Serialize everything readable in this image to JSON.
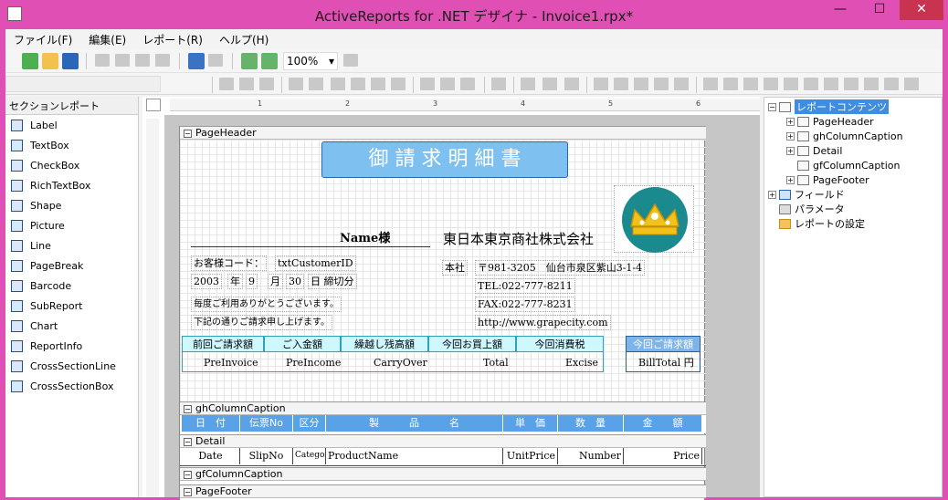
{
  "window": {
    "title": "ActiveReports for .NET デザイナ - Invoice1.rpx*",
    "close_glyph": "✕",
    "minimize_glyph": "—",
    "maximize_glyph": "☐"
  },
  "menu": [
    "ファイル(F)",
    "編集(E)",
    "レポート(R)",
    "ヘルプ(H)"
  ],
  "toolbar": {
    "zoom": "100%",
    "zoom_arrow": "▾"
  },
  "toolbox": {
    "header": "セクションレポート",
    "items": [
      "Label",
      "TextBox",
      "CheckBox",
      "RichTextBox",
      "Shape",
      "Picture",
      "Line",
      "PageBreak",
      "Barcode",
      "SubReport",
      "Chart",
      "ReportInfo",
      "CrossSectionLine",
      "CrossSectionBox"
    ]
  },
  "ruler": {
    "marks": [
      "1",
      "2",
      "3",
      "4",
      "5",
      "6"
    ]
  },
  "report": {
    "sections": {
      "page_header": "PageHeader",
      "gh": "ghColumnCaption",
      "detail": "Detail",
      "gf": "gfColumnCaption",
      "page_footer": "PageFooter"
    },
    "title": "御 請 求 明 細 書",
    "customer_name": "Name様",
    "company": "東日本東京商社株式会社",
    "customer_code_label": "お客様コード：",
    "customer_code": "txtCustomerID",
    "address_label": "本社",
    "address": "〒981-3205　仙台市泉区紫山3-1-4",
    "date_year": "2003",
    "date_year_unit": "年",
    "date_month": "9",
    "date_month_unit": "月",
    "date_day": "30",
    "date_close": "日 締切分",
    "tel": "TEL:022-777-8211",
    "fax": "FAX:022-777-8231",
    "url": "http://www.grapecity.com",
    "msg1": "毎度ご利用ありがとうございます。",
    "msg2": "下記の通りご請求申し上げます。",
    "summary_headers": [
      "前回ご請求額",
      "ご入金額",
      "繰越し残高額",
      "今回お買上額",
      "今回消費税",
      "今回ご請求額"
    ],
    "summary_fields": [
      "PreInvoice",
      "PreIncome",
      "CarryOver",
      "Total",
      "Excise",
      "BillTotal 円"
    ],
    "column_captions": [
      "日　付",
      "伝票No",
      "区分",
      "製　　　品　　　名",
      "単　価",
      "数　量",
      "金　　額"
    ],
    "detail_fields": [
      "Date",
      "SlipNo",
      "Category",
      "ProductName",
      "UnitPrice",
      "Number",
      "Price"
    ]
  },
  "tree": {
    "root": "レポートコンテンツ",
    "sections": [
      "PageHeader",
      "ghColumnCaption",
      "Detail",
      "gfColumnCaption",
      "PageFooter"
    ],
    "others": [
      "フィールド",
      "パラメータ",
      "レポートの設定"
    ]
  },
  "colors": {
    "accent": "#e04fb3",
    "caption": "#cdf8ff",
    "header_blue": "#5aa2e8",
    "selection": "#3f8de0"
  }
}
